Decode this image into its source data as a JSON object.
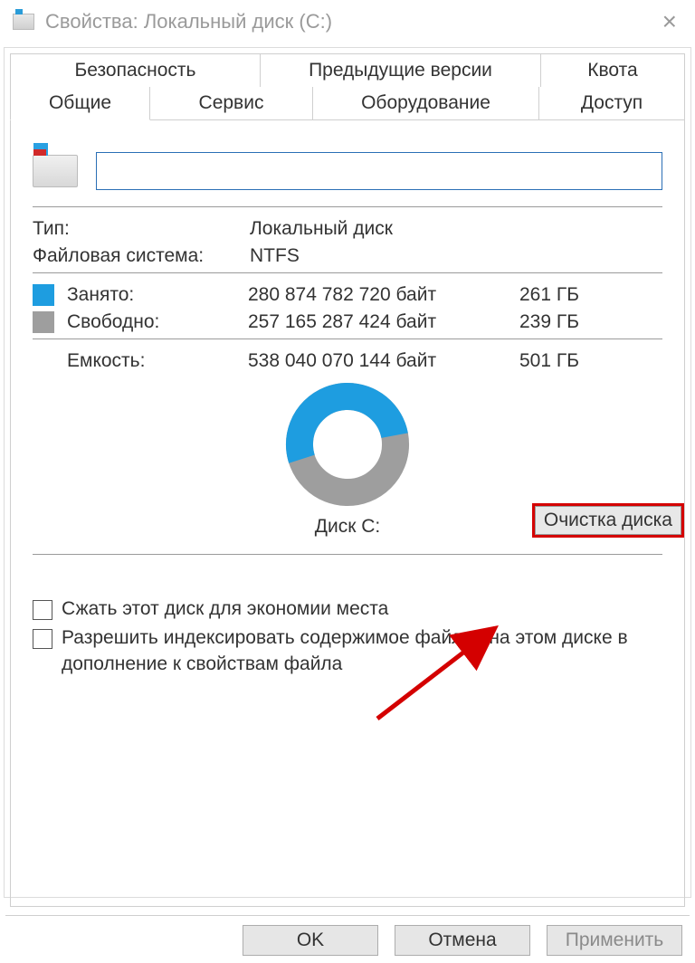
{
  "title": "Свойства: Локальный диск (C:)",
  "tabs": {
    "security": "Безопасность",
    "previous": "Предыдущие версии",
    "quota": "Квота",
    "general": "Общие",
    "tools": "Сервис",
    "hardware": "Оборудование",
    "sharing": "Доступ"
  },
  "name_value": "",
  "type_label": "Тип:",
  "type_value": "Локальный диск",
  "fs_label": "Файловая система:",
  "fs_value": "NTFS",
  "used": {
    "label": "Занято:",
    "bytes": "280 874 782 720 байт",
    "gb": "261 ГБ"
  },
  "free": {
    "label": "Свободно:",
    "bytes": "257 165 287 424 байт",
    "gb": "239 ГБ"
  },
  "cap": {
    "label": "Емкость:",
    "bytes": "538 040 070 144 байт",
    "gb": "501 ГБ"
  },
  "disk_label": "Диск C:",
  "cleanup": "Очистка диска",
  "compress": "Сжать этот диск для экономии места",
  "index": "Разрешить индексировать содержимое файлов на этом диске в дополнение к свойствам файла",
  "buttons": {
    "ok": "OK",
    "cancel": "Отмена",
    "apply": "Применить"
  },
  "colors": {
    "used": "#1e9de0",
    "free": "#9e9e9e",
    "highlight": "#d40000"
  },
  "chart_data": {
    "type": "pie",
    "title": "Диск C:",
    "series": [
      {
        "name": "Занято",
        "value": 261,
        "unit": "ГБ",
        "color": "#1e9de0"
      },
      {
        "name": "Свободно",
        "value": 239,
        "unit": "ГБ",
        "color": "#9e9e9e"
      }
    ],
    "total": {
      "label": "Емкость",
      "value": 501,
      "unit": "ГБ"
    }
  }
}
